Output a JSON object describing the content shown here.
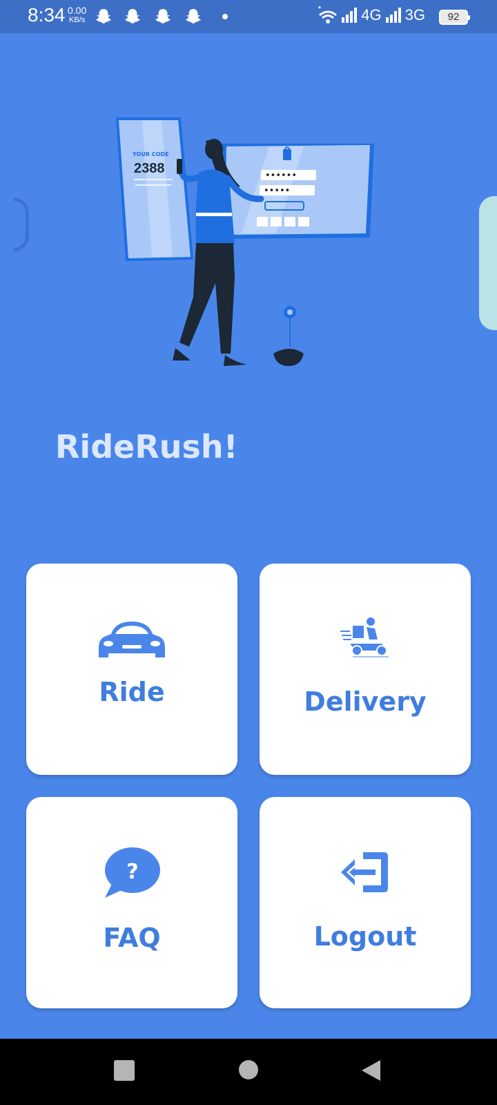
{
  "status_bar": {
    "time": "8:34",
    "speed_value": "0.00",
    "speed_unit": "KB/s",
    "network_1": "4G",
    "network_2": "3G",
    "battery": "92",
    "icons": [
      "snapchat-icon",
      "snapchat-icon",
      "snapchat-icon",
      "snapchat-icon",
      "notification-dot-icon",
      "wifi-icon",
      "signal-icon",
      "signal-icon",
      "battery-icon"
    ]
  },
  "hero": {
    "code_label": "YOUR CODE",
    "code_value": "2388",
    "password_mask_1": "••••••",
    "password_mask_2": "•••••"
  },
  "app": {
    "title": "RideRush!"
  },
  "menu": {
    "ride": {
      "label": "Ride",
      "icon": "car-icon"
    },
    "delivery": {
      "label": "Delivery",
      "icon": "delivery-scooter-icon"
    },
    "faq": {
      "label": "FAQ",
      "icon": "question-bubble-icon"
    },
    "logout": {
      "label": "Logout",
      "icon": "logout-icon"
    }
  },
  "nav": {
    "icons": [
      "recents-square-icon",
      "home-circle-icon",
      "back-triangle-icon"
    ]
  },
  "colors": {
    "background": "#4a86ea",
    "status_bar": "#3d6fc6",
    "accent": "#3f7de0",
    "tile": "#ffffff",
    "title": "#dce8ff"
  }
}
